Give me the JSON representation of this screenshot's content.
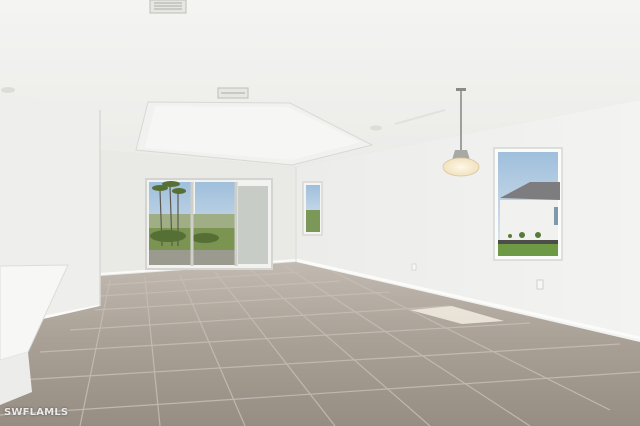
{
  "watermark": {
    "text": "SWFLAMLS"
  },
  "colors": {
    "wall": "#f0f0ee",
    "wall_shadow": "#e4e4e1",
    "ceiling": "#f6f6f4",
    "floor": "#a69d93",
    "grout": "#c9c1b8",
    "sky": "#c9dbe9",
    "grass": "#6f8f44"
  }
}
